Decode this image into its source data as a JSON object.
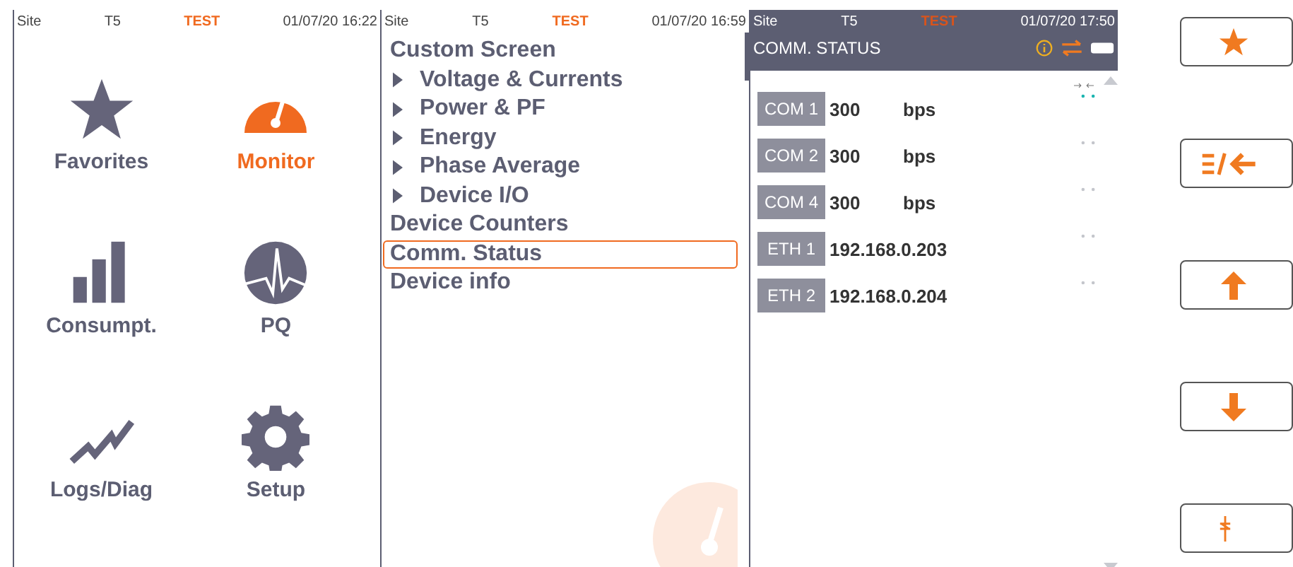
{
  "home_screen": {
    "status_bar": {
      "site": "Site",
      "unit": "T5",
      "mode": "TEST",
      "time": "01/07/20 16:22"
    },
    "tiles": [
      {
        "kind": "star",
        "label": "Favorites",
        "selected": false
      },
      {
        "kind": "gauge",
        "label": "Monitor",
        "selected": true
      },
      {
        "kind": "bars",
        "label": "Consumpt.",
        "selected": false
      },
      {
        "kind": "pulse",
        "label": "PQ",
        "selected": false
      },
      {
        "kind": "trend",
        "label": "Logs/Diag",
        "selected": false
      },
      {
        "kind": "gear",
        "label": "Setup",
        "selected": false
      }
    ]
  },
  "monitor_screen": {
    "status_bar": {
      "site": "Site",
      "unit": "T5",
      "mode": "TEST",
      "time": "01/07/20 16:59"
    },
    "items": [
      {
        "label": "Custom Screen",
        "expandable": false,
        "selected": false
      },
      {
        "label": "Voltage & Currents",
        "expandable": true,
        "selected": false
      },
      {
        "label": "Power & PF",
        "expandable": true,
        "selected": false
      },
      {
        "label": "Energy",
        "expandable": true,
        "selected": false
      },
      {
        "label": "Phase Average",
        "expandable": true,
        "selected": false
      },
      {
        "label": "Device I/O",
        "expandable": true,
        "selected": false
      },
      {
        "label": "Device Counters",
        "expandable": false,
        "selected": false
      },
      {
        "label": "Comm. Status",
        "expandable": false,
        "selected": true
      },
      {
        "label": "Device info",
        "expandable": false,
        "selected": false
      }
    ]
  },
  "comm_screen": {
    "status_bar": {
      "site": "Site",
      "unit": "T5",
      "mode": "TEST",
      "time": "01/07/20 17:50"
    },
    "title": "COMM. STATUS",
    "ports": [
      {
        "name": "COM 1",
        "value": "300",
        "unit": "bps",
        "active": true
      },
      {
        "name": "COM 2",
        "value": "300",
        "unit": "bps",
        "active": false
      },
      {
        "name": "COM 4",
        "value": "300",
        "unit": "bps",
        "active": false
      },
      {
        "name": "ETH 1",
        "value": "192.168.0.203",
        "active": false
      },
      {
        "name": "ETH 2",
        "value": "192.168.0.204",
        "active": false
      }
    ]
  },
  "side_buttons": [
    {
      "kind": "star"
    },
    {
      "kind": "toggle"
    },
    {
      "kind": "up"
    },
    {
      "kind": "down"
    },
    {
      "kind": "tool"
    }
  ]
}
